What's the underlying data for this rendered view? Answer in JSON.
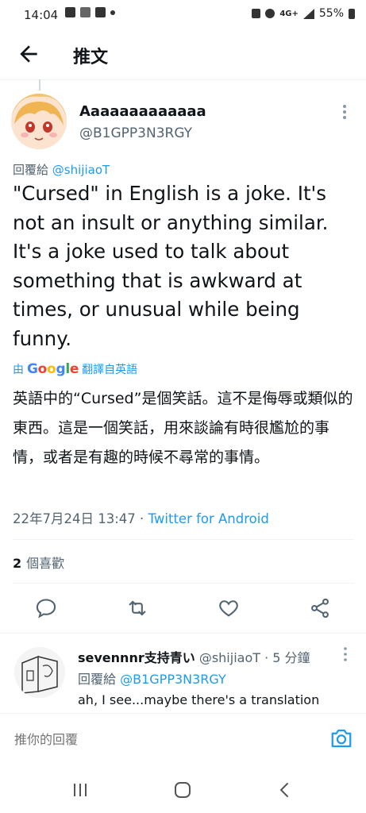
{
  "status_bar": {
    "time": "14:04",
    "battery": "55%",
    "network": "4G+"
  },
  "appbar": {
    "title": "推文"
  },
  "tweet": {
    "display_name": "Aaaaaaaaaaaaa",
    "handle": "@B1GPP3N3RGY",
    "reply_prefix": "回覆給",
    "reply_to": "@shijiaoT",
    "text": "\"Cursed\" in English is a joke. It's not an insult or anything similar. It's a joke used to talk about something that is awkward at times, or unusual while being funny.",
    "translated_by_prefix": "由",
    "translated_by_brand": "Google",
    "translated_by_suffix": "翻譯自英語",
    "translated_text": "英語中的“Cursed”是個笑話。這不是侮辱或類似的東西。這是一個笑話，用來談論有時很尷尬的事情，或者是有趣的時候不尋常的事情。",
    "timestamp": "22年7月24日 13:47",
    "separator": " · ",
    "source": "Twitter for Android",
    "likes_count": "2",
    "likes_label": "個喜歡"
  },
  "reply": {
    "display_name": "sevennnr支持青い",
    "handle": "@shijiaoT",
    "time": "· 5 分鐘",
    "reply_prefix": "回覆給",
    "reply_to": "@B1GPP3N3RGY",
    "text": "ah, I see...maybe there's a translation"
  },
  "compose": {
    "placeholder": "推你的回覆"
  },
  "colors": {
    "accent": "#1d9bf0",
    "secondary_text": "#536471"
  }
}
